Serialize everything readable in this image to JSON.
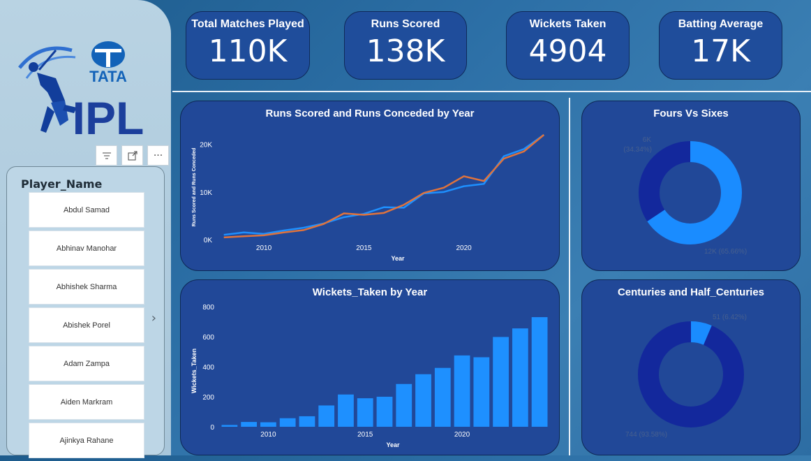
{
  "brand": {
    "top_word": "TATA",
    "bottom_word": "IPL"
  },
  "toolbar": {
    "filter_icon": "filter-icon",
    "focus_icon": "focus-mode-icon",
    "more_icon": "more-options-icon"
  },
  "slicer": {
    "title": "Player_Name",
    "items": [
      "Abdul Samad",
      "Abhinav Manohar",
      "Abhishek Sharma",
      "Abishek Porel",
      "Adam Zampa",
      "Aiden Markram",
      "Ajinkya Rahane"
    ]
  },
  "kpis": [
    {
      "label": "Total Matches Played",
      "value": "110K"
    },
    {
      "label": "Runs Scored",
      "value": "138K"
    },
    {
      "label": "Wickets Taken",
      "value": "4904"
    },
    {
      "label": "Batting Average",
      "value": "17K"
    }
  ],
  "colors": {
    "blue_series": "#1e90ff",
    "orange_series": "#e0733c",
    "donut_dark": "#13289c",
    "donut_light": "#1a8cff"
  },
  "chart_data": [
    {
      "type": "line",
      "title": "Runs Scored and Runs Conceded by Year",
      "xlabel": "Year",
      "ylabel": "Runs Scored and Runs Conceded",
      "x": [
        2008,
        2009,
        2010,
        2011,
        2012,
        2013,
        2014,
        2015,
        2016,
        2017,
        2018,
        2019,
        2020,
        2021,
        2022,
        2023,
        2024
      ],
      "xticks": [
        2010,
        2015,
        2020
      ],
      "yticks": [
        0,
        10000,
        20000
      ],
      "ytick_labels": [
        "0K",
        "10K",
        "20K"
      ],
      "ylim": [
        0,
        22000
      ],
      "series": [
        {
          "color": "#1e90ff",
          "values": [
            1000,
            1500,
            1200,
            1900,
            2500,
            3400,
            4700,
            5400,
            6800,
            6700,
            9700,
            10000,
            11200,
            11700,
            17500,
            19000,
            22000
          ]
        },
        {
          "color": "#e0733c",
          "values": [
            450,
            700,
            900,
            1500,
            2000,
            3300,
            5500,
            5200,
            5600,
            7300,
            9800,
            10900,
            13300,
            12300,
            17000,
            18500,
            22000
          ]
        }
      ]
    },
    {
      "type": "bar",
      "title": "Wickets_Taken by Year",
      "xlabel": "Year",
      "ylabel": "Wickets_Taken",
      "x": [
        2008,
        2009,
        2010,
        2011,
        2012,
        2013,
        2014,
        2015,
        2016,
        2017,
        2018,
        2019,
        2020,
        2021,
        2022,
        2023,
        2024
      ],
      "values": [
        12,
        32,
        30,
        57,
        70,
        142,
        215,
        190,
        200,
        285,
        350,
        392,
        475,
        463,
        598,
        655,
        730
      ],
      "xticks": [
        2010,
        2015,
        2020
      ],
      "yticks": [
        0,
        200,
        400,
        600,
        800
      ],
      "ylim": [
        0,
        800
      ]
    },
    {
      "type": "pie",
      "title": "Fours Vs Sixes",
      "slices": [
        {
          "value": 6000,
          "percent": 34.34,
          "label": "6K",
          "pct_label": "(34.34%)",
          "color": "#13289c"
        },
        {
          "value": 12000,
          "percent": 65.66,
          "label": "12K (65.66%)",
          "color": "#1a8cff"
        }
      ]
    },
    {
      "type": "pie",
      "title": "Centuries and Half_Centuries",
      "slices": [
        {
          "value": 51,
          "percent": 6.42,
          "label": "51 (6.42%)",
          "color": "#1a8cff"
        },
        {
          "value": 744,
          "percent": 93.58,
          "label": "744 (93.58%)",
          "color": "#13289c"
        }
      ]
    }
  ]
}
